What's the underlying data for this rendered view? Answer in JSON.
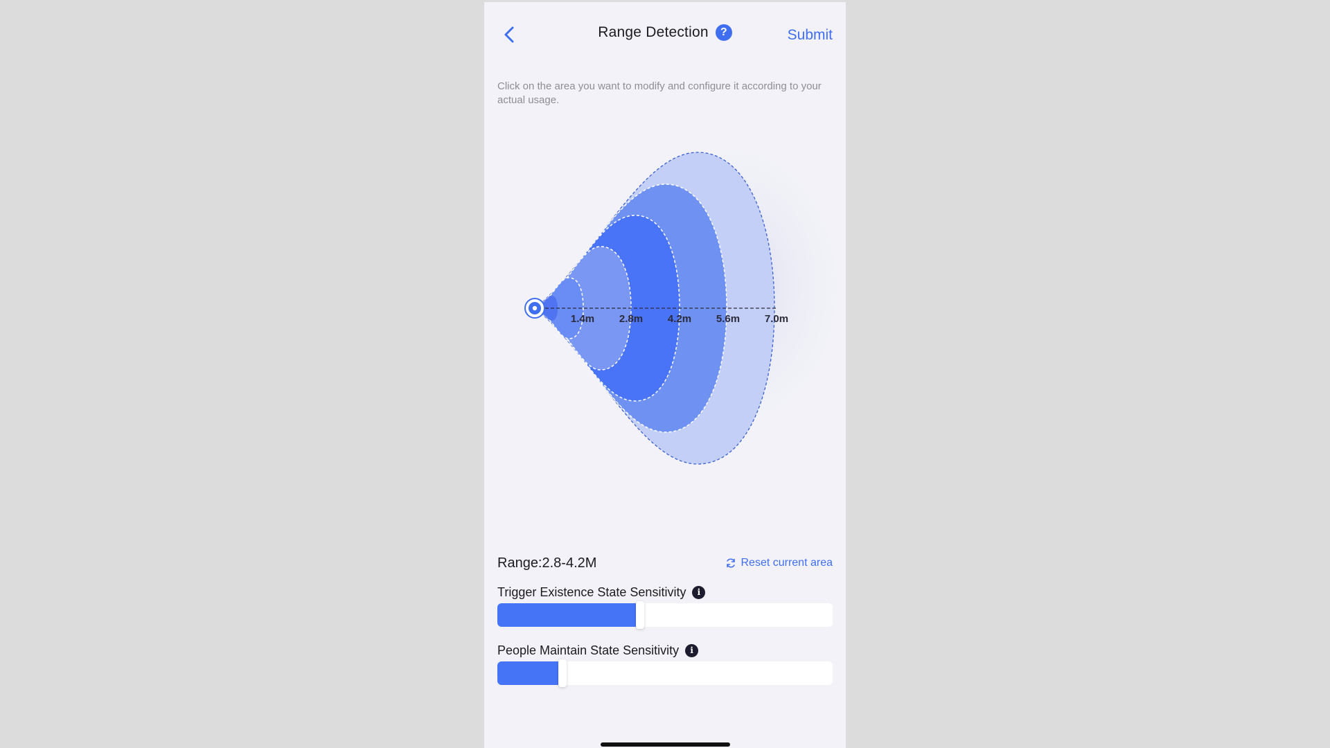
{
  "header": {
    "title": "Range Detection",
    "help_glyph": "?",
    "submit_label": "Submit",
    "back_icon": "chevron-left-icon"
  },
  "instructions": "Click on the area you want to modify and configure it according to your actual usage.",
  "diagram": {
    "zone_labels": [
      "1.4m",
      "2.8m",
      "4.2m",
      "5.6m",
      "7.0m"
    ],
    "selected_zone_index": 2,
    "colors": {
      "zone_1": "#6a8cf5",
      "zone_2": "#7b97f4",
      "zone_3": "#4a74f8",
      "zone_4": "#6f92f2",
      "zone_5": "#c4cff8",
      "sensor": "#3f6ef0"
    }
  },
  "panel": {
    "range_label": "Range:2.8-4.2M",
    "reset_label": "Reset current area",
    "sliders": [
      {
        "label": "Trigger Existence State Sensitivity",
        "info_glyph": "i",
        "value_fraction": 0.425
      },
      {
        "label": "People Maintain State Sensitivity",
        "info_glyph": "i",
        "value_fraction": 0.195
      }
    ]
  },
  "colors": {
    "accent": "#3f6ef0",
    "slider_fill": "#4674f6",
    "background": "#f2f2f8",
    "outer_background": "#dcdcdc"
  }
}
